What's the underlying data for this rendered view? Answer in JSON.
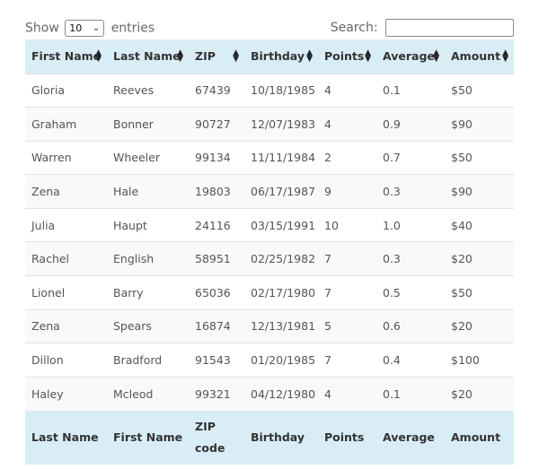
{
  "length": {
    "label_before": "Show",
    "value": "10",
    "label_after": "entries"
  },
  "search": {
    "label": "Search:",
    "value": ""
  },
  "columns": [
    "First Name",
    "Last Name",
    "ZIP",
    "Birthday",
    "Points",
    "Average",
    "Amount"
  ],
  "footer": [
    "Last Name",
    "First Name",
    "ZIP code",
    "Birthday",
    "Points",
    "Average",
    "Amount"
  ],
  "rows": [
    [
      "Gloria",
      "Reeves",
      "67439",
      "10/18/1985",
      "4",
      "0.1",
      "$50"
    ],
    [
      "Graham",
      "Bonner",
      "90727",
      "12/07/1983",
      "4",
      "0.9",
      "$90"
    ],
    [
      "Warren",
      "Wheeler",
      "99134",
      "11/11/1984",
      "2",
      "0.7",
      "$50"
    ],
    [
      "Zena",
      "Hale",
      "19803",
      "06/17/1987",
      "9",
      "0.3",
      "$90"
    ],
    [
      "Julia",
      "Haupt",
      "24116",
      "03/15/1991",
      "10",
      "1.0",
      "$40"
    ],
    [
      "Rachel",
      "English",
      "58951",
      "02/25/1982",
      "7",
      "0.3",
      "$20"
    ],
    [
      "Lionel",
      "Barry",
      "65036",
      "02/17/1980",
      "7",
      "0.5",
      "$50"
    ],
    [
      "Zena",
      "Spears",
      "16874",
      "12/13/1981",
      "5",
      "0.6",
      "$20"
    ],
    [
      "Dillon",
      "Bradford",
      "91543",
      "01/20/1985",
      "7",
      "0.4",
      "$100"
    ],
    [
      "Haley",
      "Mcleod",
      "99321",
      "04/12/1980",
      "4",
      "0.1",
      "$20"
    ]
  ],
  "icons": {
    "sort": "sort-both-icon",
    "dropdown": "chevron-down-icon"
  },
  "colors": {
    "header_bg": "#d9edf7",
    "stripe_bg": "#f9f9f9",
    "border": "#e2e2e2"
  }
}
